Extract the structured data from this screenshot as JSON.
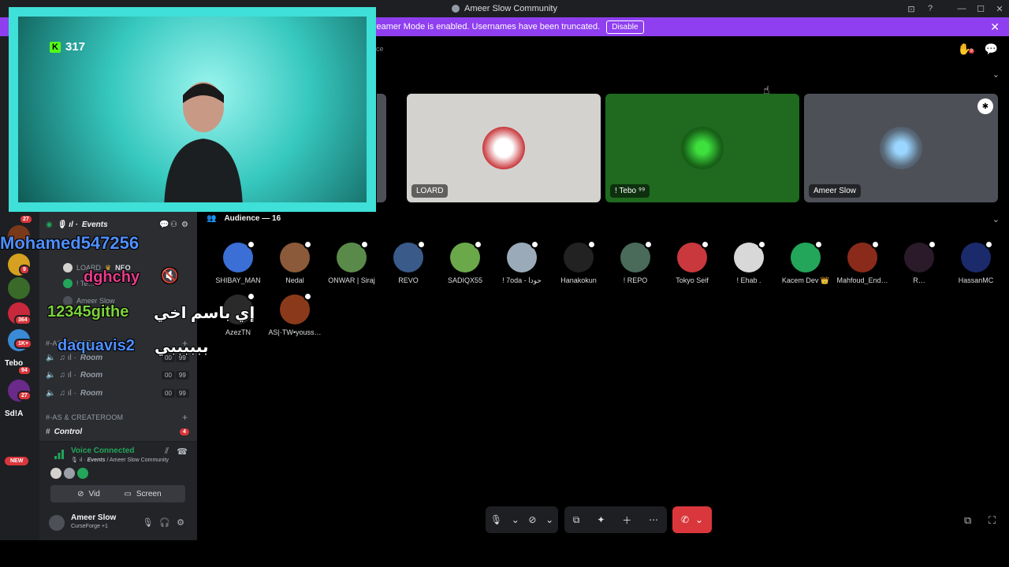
{
  "window": {
    "title": "Ameer Slow Community",
    "controls": [
      "⊡",
      "?",
      "—",
      "☐",
      "✕"
    ]
  },
  "banner": {
    "text": "Streamer Mode is enabled. Usernames have been truncated.",
    "button": "Disable"
  },
  "guilds": {
    "badges": [
      "27",
      "9",
      "364",
      "1K+",
      "94",
      "27"
    ],
    "labels": [
      "Tebo",
      "Sd!A"
    ],
    "new_pill": "NEW"
  },
  "channels": {
    "events_channel": "Events",
    "events_prefix": "🎙 ıl ·",
    "members": [
      {
        "name": "LOARD",
        "tag": "NEO"
      },
      {
        "name": "! Te…"
      },
      {
        "name": "Ameer Slow"
      }
    ],
    "category_voice": "#-AS | VOICE",
    "rooms": [
      {
        "name": "Room",
        "c1": "00",
        "c2": "99"
      },
      {
        "name": "Room",
        "c1": "00",
        "c2": "99"
      },
      {
        "name": "Room",
        "c1": "00",
        "c2": "99"
      }
    ],
    "room_prefix": "♫ ıl ·",
    "category_create": "#-AS & CREATEROOM",
    "control_channel": "Control",
    "control_badge": "4"
  },
  "voice": {
    "status": "Voice Connected",
    "channel": "Events",
    "server": "Ameer Slow Community",
    "video_label": "Video",
    "screen_label": "Screen"
  },
  "user": {
    "name": "Ameer Slow",
    "status": "CurseForge +1"
  },
  "main": {
    "audience_crumb": "nce",
    "notif_badge": "9",
    "tiles": [
      {
        "name": "LOARD",
        "bg": "#d4d2cf"
      },
      {
        "name": "! Tebo ⁹⁹",
        "bg": "#1f6a1f"
      },
      {
        "name": "Ameer Slow",
        "bg": "#4e5058"
      }
    ],
    "audience_header": "Audience — 16",
    "audience": [
      {
        "name": "SHIBAY_MAN",
        "color": "#3b6fd6"
      },
      {
        "name": "Nedal",
        "color": "#8a5a3a"
      },
      {
        "name": "ONWAR | Siraj",
        "color": "#5a8a4a"
      },
      {
        "name": "REVO",
        "color": "#3a5a8a"
      },
      {
        "name": "SADIQX55",
        "color": "#6aa84a"
      },
      {
        "name": "! 7oda - حودا",
        "color": "#9aaab8"
      },
      {
        "name": "Hanakokun",
        "color": "#222222"
      },
      {
        "name": "! REPO",
        "color": "#4a6a5a"
      },
      {
        "name": "Tokyo Seif",
        "color": "#c8383c"
      },
      {
        "name": "! Ehab .",
        "color": "#d8d8d8"
      },
      {
        "name": "Kacem Dev 👑",
        "color": "#23a55a"
      },
      {
        "name": "Mahfoud_End…",
        "color": "#8a2a1a"
      },
      {
        "name": "R…",
        "color": "#2a1a2a"
      },
      {
        "name": "HassanMC",
        "color": "#1a2a6a"
      },
      {
        "name": "AzezTN",
        "color": "#2a2a2a"
      },
      {
        "name": "AS|·TW•youss…",
        "color": "#8a3a1a"
      }
    ]
  },
  "callbar": {
    "mic": "🎙",
    "video_off": "⊘",
    "share": "⧉",
    "activity": "✦",
    "invite": "＋",
    "more": "⋯",
    "end": "✆",
    "chev": "⌄"
  },
  "stream_overlay": {
    "viewer_count": "317",
    "kick_logo": "K",
    "chat": [
      {
        "text": "Mohamed547256",
        "color": "#4f8fff"
      },
      {
        "text": "dghchy",
        "color": "#e83c8c"
      },
      {
        "text": "12345githe",
        "color": "#7cd33c"
      },
      {
        "text": "إي باسم اخي",
        "color": "#ffffff"
      },
      {
        "text": "daquavis2",
        "color": "#4f8fff"
      },
      {
        "text": "ببببببي",
        "color": "#ffffff"
      }
    ]
  },
  "colors": {
    "accent": "#5865f2",
    "streamer_banner": "#8f3ff0",
    "danger": "#da373c",
    "connected": "#23a55a"
  }
}
